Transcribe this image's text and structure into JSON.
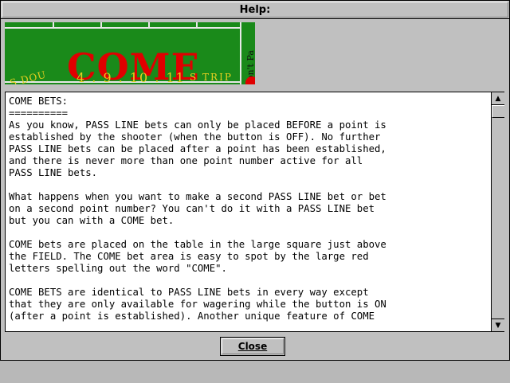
{
  "window": {
    "title": "Help:"
  },
  "banner": {
    "main_text": "COME",
    "side_text": "Don't Pa",
    "numbers_text": "4 . 9 . 10 . 11",
    "corner_text": "S DOU",
    "tail_text": "S TRIP"
  },
  "help": {
    "text": "COME BETS:\n==========\nAs you know, PASS LINE bets can only be placed BEFORE a point is\nestablished by the shooter (when the button is OFF). No further\nPASS LINE bets can be placed after a point has been established,\nand there is never more than one point number active for all\nPASS LINE bets.\n\nWhat happens when you want to make a second PASS LINE bet or bet\non a second point number? You can't do it with a PASS LINE bet\nbut you can with a COME bet.\n\nCOME bets are placed on the table in the large square just above\nthe FIELD. The COME bet area is easy to spot by the large red\nletters spelling out the word \"COME\".\n\nCOME BETS are identical to PASS LINE bets in every way except\nthat they are only available for wagering while the button is ON\n(after a point is established). Another unique feature of COME"
  },
  "scrollbar": {
    "up_icon": "▲",
    "down_icon": "▼"
  },
  "buttons": {
    "close_label": "Close"
  }
}
